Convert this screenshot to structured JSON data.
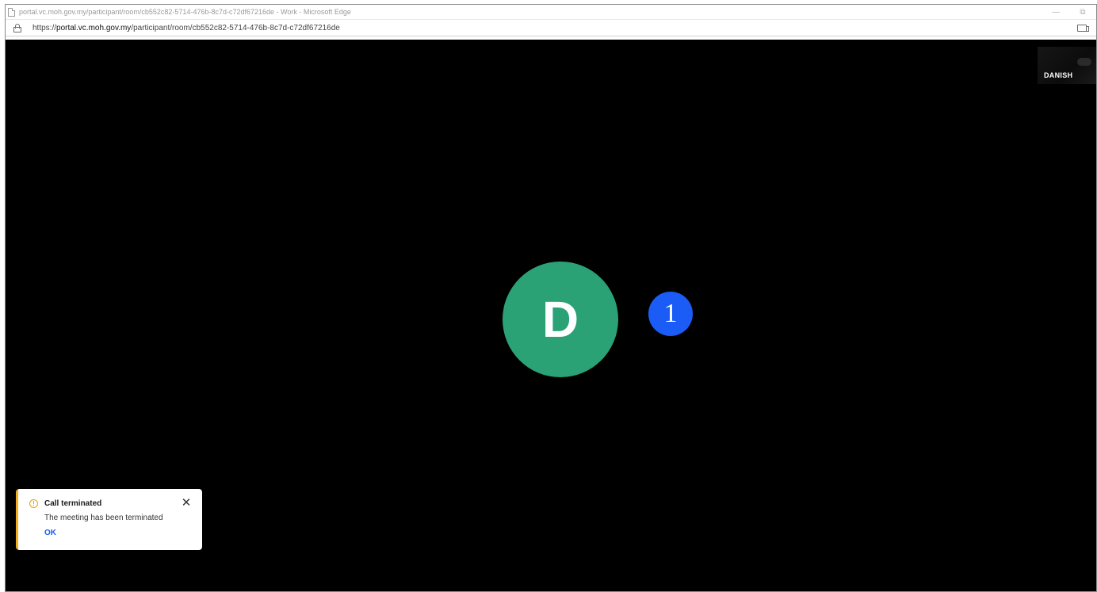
{
  "browser": {
    "window_title": "portal.vc.moh.gov.my/participant/room/cb552c82-5714-476b-8c7d-c72df67216de - Work - Microsoft Edge",
    "url_prefix": "https://",
    "url_host": "portal.vc.moh.gov.my",
    "url_path": "/participant/room/cb552c82-5714-476b-8c7d-c72df67216de",
    "minimize_glyph": "—",
    "restore_glyph": "⧉"
  },
  "meeting": {
    "self_view_name": "DANISH",
    "avatar_initial": "D",
    "avatar_color": "#2ba176",
    "participant_count": "1",
    "badge_color": "#1a5cf5"
  },
  "toast": {
    "icon": "warning-icon",
    "title": "Call terminated",
    "message": "The meeting has been terminated",
    "ok_label": "OK",
    "close_glyph": "✕",
    "accent_color": "#f0ad1c"
  }
}
